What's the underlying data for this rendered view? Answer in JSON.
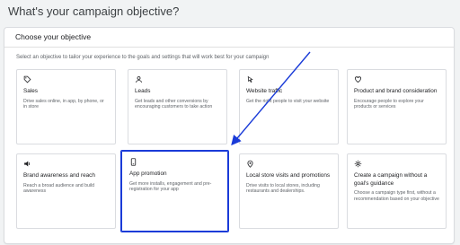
{
  "page": {
    "title": "What's your campaign objective?"
  },
  "panel": {
    "title": "Choose your objective",
    "subtitle": "Select an objective to tailor your experience to the goals and settings that will work best for your campaign"
  },
  "cards": [
    {
      "icon": "tag-icon",
      "title": "Sales",
      "desc": "Drive sales online, in app, by phone, or in store"
    },
    {
      "icon": "leads-icon",
      "title": "Leads",
      "desc": "Get leads and other conversions by encouraging customers to take action"
    },
    {
      "icon": "cursor-click-icon",
      "title": "Website traffic",
      "desc": "Get the right people to visit your website"
    },
    {
      "icon": "heart-icon",
      "title": "Product and brand consideration",
      "desc": "Encourage people to explore your products or services"
    },
    {
      "icon": "speaker-icon",
      "title": "Brand awareness and reach",
      "desc": "Reach a broad audience and build awareness"
    },
    {
      "icon": "phone-icon",
      "title": "App promotion",
      "desc": "Get more installs, engagement and pre-registration for your app"
    },
    {
      "icon": "location-pin-icon",
      "title": "Local store visits and promotions",
      "desc": "Drive visits to local stores, including restaurants and dealerships."
    },
    {
      "icon": "gear-icon",
      "title": "Create a campaign without a goal's guidance",
      "desc": "Choose a campaign type first, without a recommendation based on your objective"
    }
  ],
  "selected_card": "App promotion",
  "annotation": {
    "arrow_color": "#1a3bd8"
  }
}
